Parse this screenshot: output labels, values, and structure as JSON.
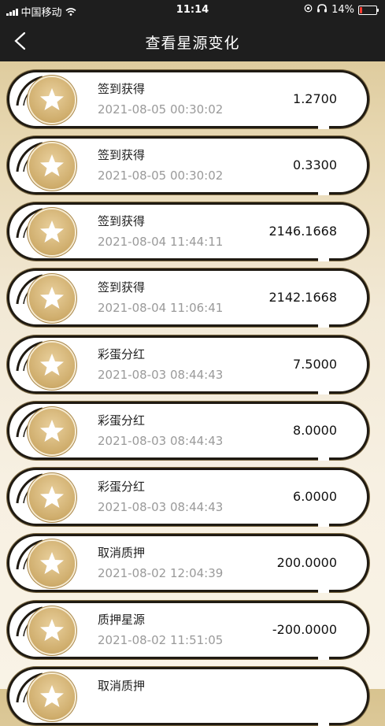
{
  "status_bar": {
    "carrier": "中国移动",
    "time": "11:14",
    "battery_percent": "14%",
    "icons": [
      "signal-icon",
      "wifi-icon",
      "location-icon",
      "headphones-icon",
      "battery-icon"
    ]
  },
  "header": {
    "title": "查看星源变化",
    "back_icon": "chevron-left-icon"
  },
  "colors": {
    "bar_bg": "#1e1e1e",
    "gold": "#cfad6c",
    "amount_text": "#111111",
    "time_text": "#9a9a9a"
  },
  "records": [
    {
      "name": "签到获得",
      "time": "2021-08-05 00:30:02",
      "amount": "1.2700"
    },
    {
      "name": "签到获得",
      "time": "2021-08-05 00:30:02",
      "amount": "0.3300"
    },
    {
      "name": "签到获得",
      "time": "2021-08-04 11:44:11",
      "amount": "2146.1668"
    },
    {
      "name": "签到获得",
      "time": "2021-08-04 11:06:41",
      "amount": "2142.1668"
    },
    {
      "name": "彩蛋分红",
      "time": "2021-08-03 08:44:43",
      "amount": "7.5000"
    },
    {
      "name": "彩蛋分红",
      "time": "2021-08-03 08:44:43",
      "amount": "8.0000"
    },
    {
      "name": "彩蛋分红",
      "time": "2021-08-03 08:44:43",
      "amount": "6.0000"
    },
    {
      "name": "取消质押",
      "time": "2021-08-02 12:04:39",
      "amount": "200.0000"
    },
    {
      "name": "质押星源",
      "time": "2021-08-02 11:51:05",
      "amount": "-200.0000"
    },
    {
      "name": "取消质押",
      "time": "",
      "amount": ""
    }
  ]
}
